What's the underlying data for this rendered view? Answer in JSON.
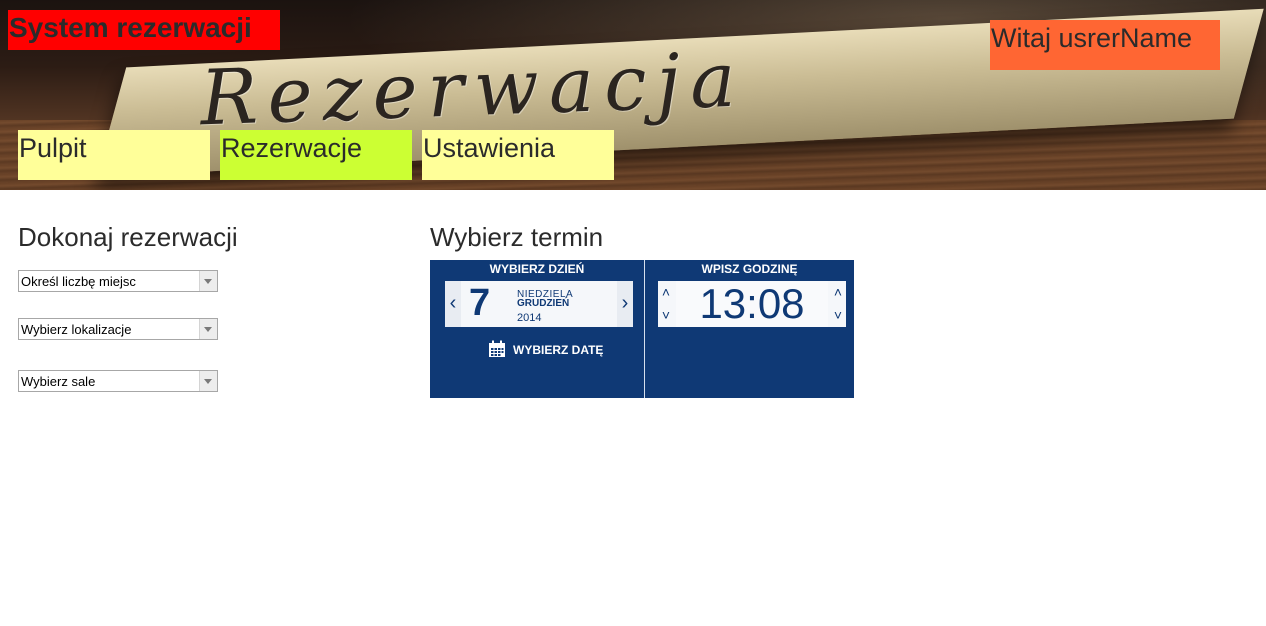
{
  "header": {
    "brand": "System rezerwacji",
    "welcome": "Witaj usrerName",
    "banner_text": "Rezerwacja"
  },
  "nav": {
    "tabs": [
      {
        "label": "Pulpit",
        "color": "#ffff99"
      },
      {
        "label": "Rezerwacje",
        "color": "#ccff33",
        "active": true
      },
      {
        "label": "Ustawienia",
        "color": "#ffff99"
      }
    ]
  },
  "form": {
    "title": "Dokonaj rezerwacji",
    "selects": [
      {
        "label": "Określ liczbę miejsc"
      },
      {
        "label": "Wybierz lokalizacje"
      },
      {
        "label": "Wybierz sale"
      }
    ]
  },
  "picker": {
    "title": "Wybierz termin",
    "day_header": "WYBIERZ DZIEŃ",
    "time_header": "WPISZ GODZINĘ",
    "day": "7",
    "weekday": "NIEDZIELA",
    "month": "GRUDZIEŃ",
    "year": "2014",
    "pick_date_label": "WYBIERZ DATĘ",
    "time": "13:08",
    "accent_color": "#0f3975"
  },
  "icons": {
    "prev": "chevron-left-icon",
    "next": "chevron-right-icon",
    "calendar": "calendar-icon",
    "up": "chevron-up-icon",
    "down": "chevron-down-icon"
  }
}
